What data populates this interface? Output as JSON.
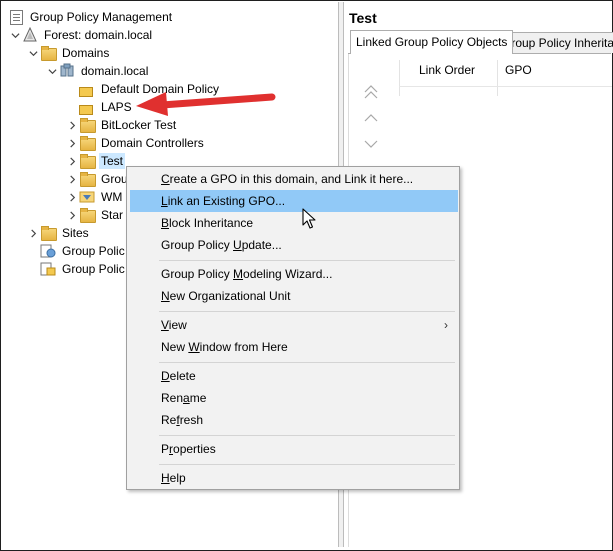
{
  "tree": {
    "root": "Group Policy Management",
    "forest": "Forest: domain.local",
    "domains": "Domains",
    "domain": "domain.local",
    "items": [
      "Default Domain Policy",
      "LAPS",
      "BitLocker Test",
      "Domain Controllers",
      "Test",
      "Grou",
      "WM",
      "Star"
    ],
    "sites": "Sites",
    "gp_modeling": "Group Polic",
    "gp_results": "Group Polic"
  },
  "right": {
    "title": "Test",
    "tabs": [
      "Linked Group Policy Objects",
      "Group Policy Inheritan"
    ],
    "columns": [
      "Link Order",
      "GPO"
    ]
  },
  "menu": {
    "items": [
      {
        "pre": "",
        "acc": "C",
        "post": "reate a GPO in this domain, and Link it here..."
      },
      {
        "pre": "",
        "acc": "L",
        "post": "ink an Existing GPO..."
      },
      {
        "pre": "",
        "acc": "B",
        "post": "lock Inheritance"
      },
      {
        "pre": "Group Policy ",
        "acc": "U",
        "post": "pdate..."
      },
      {
        "pre": "Group Policy ",
        "acc": "M",
        "post": "odeling Wizard..."
      },
      {
        "pre": "",
        "acc": "N",
        "post": "ew Organizational Unit"
      },
      {
        "pre": "",
        "acc": "V",
        "post": "iew"
      },
      {
        "pre": "New ",
        "acc": "W",
        "post": "indow from Here"
      },
      {
        "pre": "",
        "acc": "D",
        "post": "elete"
      },
      {
        "pre": "Ren",
        "acc": "a",
        "post": "me"
      },
      {
        "pre": "Re",
        "acc": "f",
        "post": "resh"
      },
      {
        "pre": "P",
        "acc": "r",
        "post": "operties"
      },
      {
        "pre": "",
        "acc": "H",
        "post": "elp"
      }
    ],
    "submenu_arrow": "›"
  },
  "colors": {
    "highlight": "#91c9f7",
    "selection": "#cce8ff",
    "annotation_arrow": "#e0302f"
  },
  "icons": [
    "gpm-root-icon",
    "forest-icon",
    "domains-folder-icon",
    "domain-icon",
    "gpo-link-icon",
    "ou-folder-icon",
    "sites-icon",
    "modeling-icon",
    "results-icon",
    "move-up-icon",
    "move-down-icon",
    "mouse-cursor-icon",
    "red-arrow-annotation"
  ]
}
